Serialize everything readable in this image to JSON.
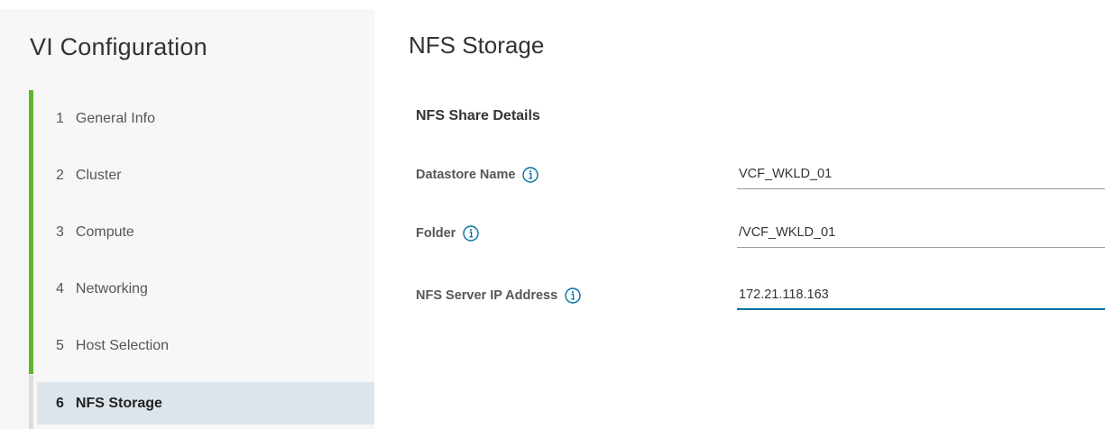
{
  "wizard": {
    "title": "VI Configuration",
    "steps": [
      {
        "number": "1",
        "label": "General Info",
        "state": "done"
      },
      {
        "number": "2",
        "label": "Cluster",
        "state": "done"
      },
      {
        "number": "3",
        "label": "Compute",
        "state": "done"
      },
      {
        "number": "4",
        "label": "Networking",
        "state": "done"
      },
      {
        "number": "5",
        "label": "Host Selection",
        "state": "done"
      },
      {
        "number": "6",
        "label": "NFS Storage",
        "state": "active"
      }
    ]
  },
  "main": {
    "title": "NFS Storage",
    "section_title": "NFS Share Details",
    "fields": [
      {
        "label": "Datastore Name",
        "value": "VCF_WKLD_01",
        "icon": "info-icon"
      },
      {
        "label": "Folder",
        "value": "/VCF_WKLD_01",
        "icon": "info-icon"
      },
      {
        "label": "NFS Server IP Address",
        "value": "172.21.118.163",
        "icon": "info-icon"
      }
    ]
  },
  "colors": {
    "completed_step": "#62b529",
    "active_step_bg": "#dce5ec",
    "focus_underline": "#0072a3",
    "info_icon": "#0072a3"
  }
}
